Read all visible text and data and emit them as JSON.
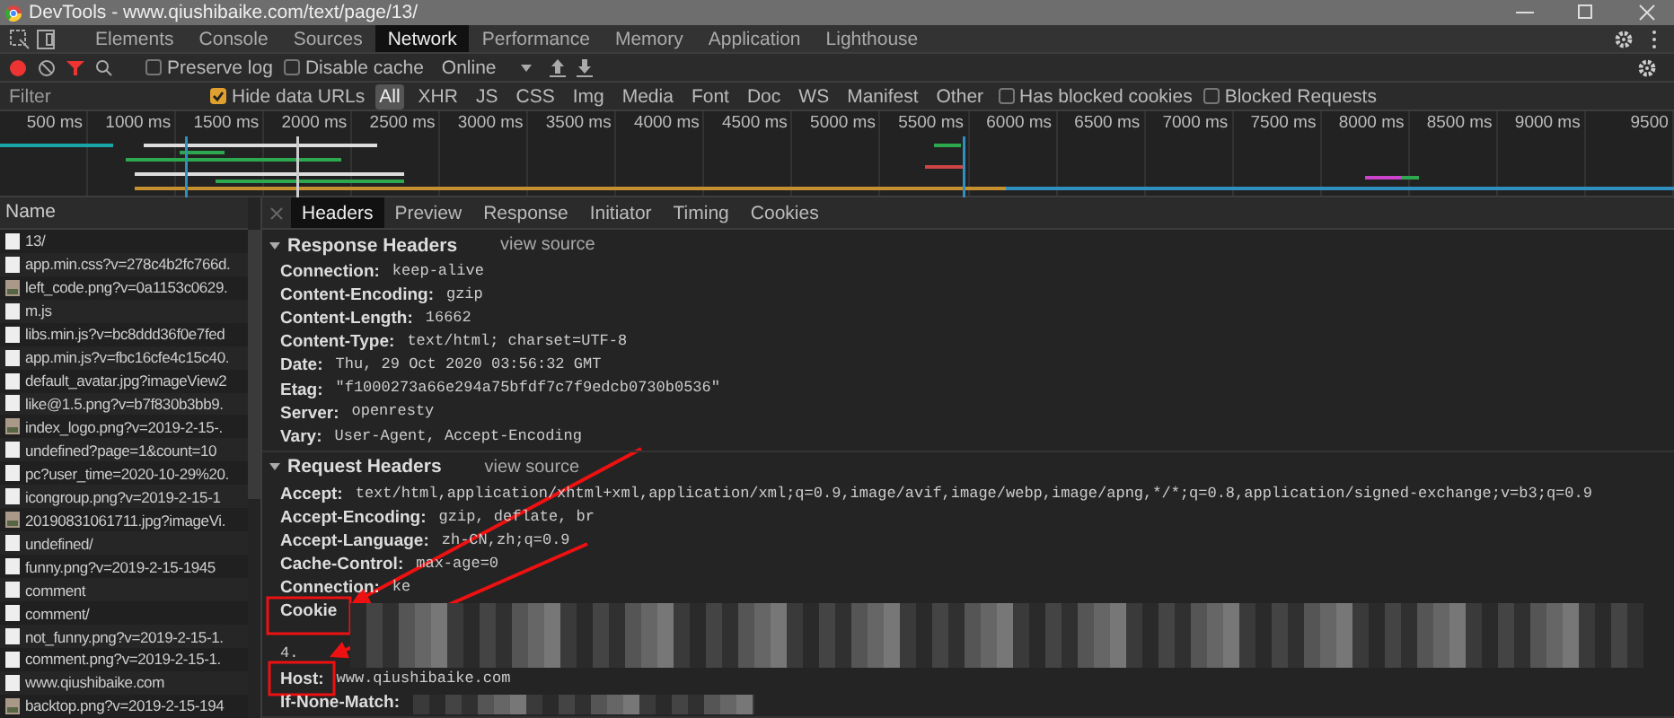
{
  "window": {
    "title": "DevTools - www.qiushibaike.com/text/page/13/"
  },
  "panel_tabs": [
    {
      "label": "Elements",
      "selected": false
    },
    {
      "label": "Console",
      "selected": false
    },
    {
      "label": "Sources",
      "selected": false
    },
    {
      "label": "Network",
      "selected": true
    },
    {
      "label": "Performance",
      "selected": false
    },
    {
      "label": "Memory",
      "selected": false
    },
    {
      "label": "Application",
      "selected": false
    },
    {
      "label": "Lighthouse",
      "selected": false
    }
  ],
  "toolbar": {
    "recording": true,
    "preserve_log": {
      "label": "Preserve log",
      "checked": false
    },
    "disable_cache": {
      "label": "Disable cache",
      "checked": false
    },
    "throttling": "Online"
  },
  "filter_bar": {
    "placeholder": "Filter",
    "hide_data_urls": {
      "label": "Hide data URLs",
      "checked": true
    },
    "types": [
      {
        "label": "All",
        "selected": true
      },
      {
        "label": "XHR",
        "selected": false
      },
      {
        "label": "JS",
        "selected": false
      },
      {
        "label": "CSS",
        "selected": false
      },
      {
        "label": "Img",
        "selected": false
      },
      {
        "label": "Media",
        "selected": false
      },
      {
        "label": "Font",
        "selected": false
      },
      {
        "label": "Doc",
        "selected": false
      },
      {
        "label": "WS",
        "selected": false
      },
      {
        "label": "Manifest",
        "selected": false
      },
      {
        "label": "Other",
        "selected": false
      }
    ],
    "has_blocked_cookies": {
      "label": "Has blocked cookies",
      "checked": false
    },
    "blocked_requests": {
      "label": "Blocked Requests",
      "checked": false
    }
  },
  "timeline": {
    "ticks": [
      "500 ms",
      "1000 ms",
      "1500 ms",
      "2000 ms",
      "2500 ms",
      "3000 ms",
      "3500 ms",
      "4000 ms",
      "4500 ms",
      "5000 ms",
      "5500 ms",
      "6000 ms",
      "6500 ms",
      "7000 ms",
      "7500 ms",
      "8000 ms",
      "8500 ms",
      "9000 ms",
      "9500"
    ]
  },
  "requests": {
    "column": "Name",
    "items": [
      {
        "name": "13/",
        "kind": "doc"
      },
      {
        "name": "app.min.css?v=278c4b2fc766d.",
        "kind": "doc"
      },
      {
        "name": "left_code.png?v=0a1153c0629.",
        "kind": "image"
      },
      {
        "name": "m.js",
        "kind": "doc"
      },
      {
        "name": "libs.min.js?v=bc8ddd36f0e7fed",
        "kind": "doc"
      },
      {
        "name": "app.min.js?v=fbc16cfe4c15c40.",
        "kind": "doc"
      },
      {
        "name": "default_avatar.jpg?imageView2",
        "kind": "doc"
      },
      {
        "name": "like@1.5.png?v=b7f830b3bb9.",
        "kind": "doc"
      },
      {
        "name": "index_logo.png?v=2019-2-15-.",
        "kind": "image"
      },
      {
        "name": "undefined?page=1&count=10",
        "kind": "doc"
      },
      {
        "name": "pc?user_time=2020-10-29%20.",
        "kind": "doc"
      },
      {
        "name": "icongroup.png?v=2019-2-15-1",
        "kind": "doc"
      },
      {
        "name": "20190831061711.jpg?imageVi.",
        "kind": "image"
      },
      {
        "name": "undefined/",
        "kind": "doc"
      },
      {
        "name": "funny.png?v=2019-2-15-1945",
        "kind": "doc"
      },
      {
        "name": "comment",
        "kind": "doc"
      },
      {
        "name": "comment/",
        "kind": "doc"
      },
      {
        "name": "not_funny.png?v=2019-2-15-1.",
        "kind": "doc"
      },
      {
        "name": "comment.png?v=2019-2-15-1.",
        "kind": "doc"
      },
      {
        "name": "www.qiushibaike.com",
        "kind": "doc"
      },
      {
        "name": "backtop.png?v=2019-2-15-194",
        "kind": "image"
      }
    ]
  },
  "detail_tabs": [
    {
      "label": "Headers",
      "selected": true
    },
    {
      "label": "Preview",
      "selected": false
    },
    {
      "label": "Response",
      "selected": false
    },
    {
      "label": "Initiator",
      "selected": false
    },
    {
      "label": "Timing",
      "selected": false
    },
    {
      "label": "Cookies",
      "selected": false
    }
  ],
  "sections": [
    {
      "title": "Response Headers",
      "link": "view source",
      "expanded": true,
      "headers": [
        {
          "name": "Connection:",
          "value": "keep-alive"
        },
        {
          "name": "Content-Encoding:",
          "value": "gzip"
        },
        {
          "name": "Content-Length:",
          "value": "16662"
        },
        {
          "name": "Content-Type:",
          "value": "text/html; charset=UTF-8"
        },
        {
          "name": "Date:",
          "value": "Thu, 29 Oct 2020 03:56:32 GMT"
        },
        {
          "name": "Etag:",
          "value": "\"f1000273a66e294a75bfdf7c7f9edcb0730b0536\""
        },
        {
          "name": "Server:",
          "value": "openresty"
        },
        {
          "name": "Vary:",
          "value": "User-Agent, Accept-Encoding"
        }
      ]
    },
    {
      "title": "Request Headers",
      "link": "view source",
      "expanded": true,
      "headers": [
        {
          "name": "Accept:",
          "value": "text/html,application/xhtml+xml,application/xml;q=0.9,image/avif,image/webp,image/apng,*/*;q=0.8,application/signed-exchange;v=b3;q=0.9"
        },
        {
          "name": "Accept-Encoding:",
          "value": "gzip, deflate, br"
        },
        {
          "name": "Accept-Language:",
          "value": "zh-CN,zh;q=0.9"
        },
        {
          "name": "Cache-Control:",
          "value": "max-age=0"
        },
        {
          "name": "Connection:",
          "value": "ke"
        },
        {
          "name": "Cookie",
          "redacted": true,
          "continuation": "4."
        },
        {
          "name": "Host:",
          "value": "www.qiushibaike.com"
        },
        {
          "name": "If-None-Match:",
          "redacted": true
        }
      ]
    }
  ]
}
